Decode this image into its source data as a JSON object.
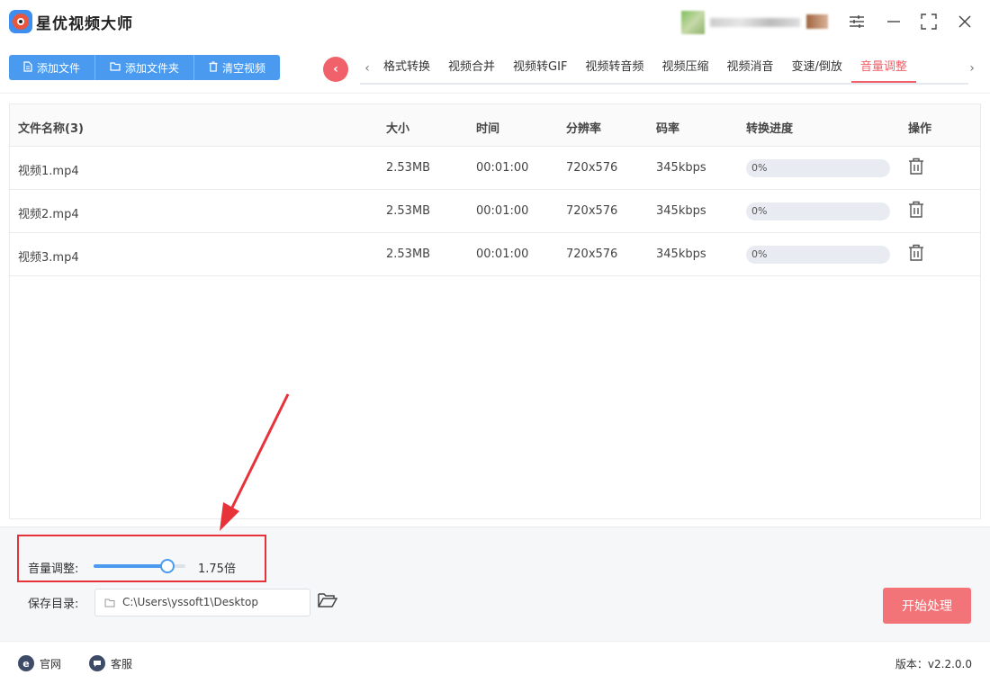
{
  "app": {
    "title": "星优视频大师"
  },
  "toolbar": {
    "add_file": "添加文件",
    "add_folder": "添加文件夹",
    "clear": "清空视频"
  },
  "tabs": [
    "格式转换",
    "视频合并",
    "视频转GIF",
    "视频转音频",
    "视频压缩",
    "视频消音",
    "变速/倒放",
    "音量调整"
  ],
  "active_tab": "音量调整",
  "table": {
    "headers": {
      "name": "文件名称(3)",
      "size": "大小",
      "time": "时间",
      "resolution": "分辨率",
      "bitrate": "码率",
      "progress": "转换进度",
      "action": "操作"
    },
    "rows": [
      {
        "name": "视频1.mp4",
        "size": "2.53MB",
        "time": "00:01:00",
        "resolution": "720x576",
        "bitrate": "345kbps",
        "progress": "0%"
      },
      {
        "name": "视频2.mp4",
        "size": "2.53MB",
        "time": "00:01:00",
        "resolution": "720x576",
        "bitrate": "345kbps",
        "progress": "0%"
      },
      {
        "name": "视频3.mp4",
        "size": "2.53MB",
        "time": "00:01:00",
        "resolution": "720x576",
        "bitrate": "345kbps",
        "progress": "0%"
      }
    ]
  },
  "volume": {
    "label": "音量调整:",
    "value_text": "1.75倍",
    "level": 0.8
  },
  "save": {
    "label": "保存目录:",
    "path": "C:\\Users\\yssoft1\\Desktop"
  },
  "start_button": "开始处理",
  "footer": {
    "website": "官网",
    "service": "客服",
    "version": "版本：v2.2.0.0"
  },
  "colors": {
    "accent_blue": "#4a9bf0",
    "accent_red": "#f0616a",
    "highlight_box": "#e8323a"
  },
  "icons": {
    "logo": "camera-lens-icon",
    "window": [
      "settings-sliders-icon",
      "minimize-icon",
      "maximize-icon",
      "close-icon"
    ]
  }
}
